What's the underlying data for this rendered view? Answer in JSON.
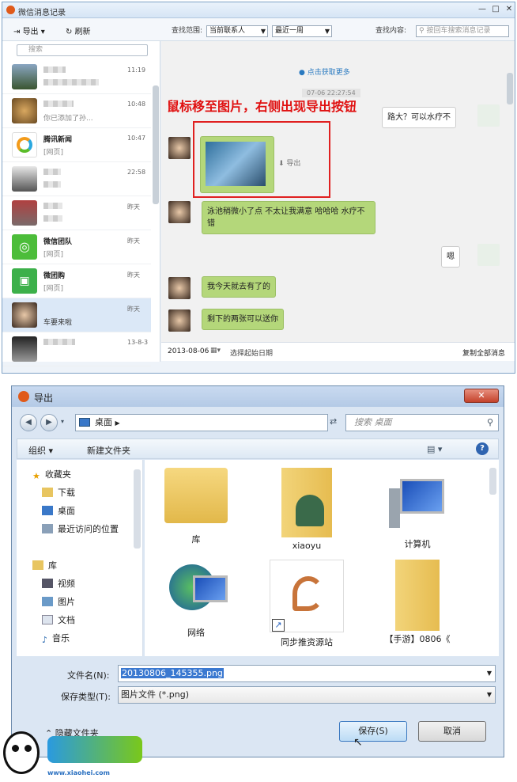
{
  "win1": {
    "title": "微信消息记录",
    "toolbar": {
      "export": "导出",
      "refresh": "刷新",
      "range_label": "查找范围:",
      "range_who": "当前联系人",
      "range_when": "最近一周",
      "content_label": "查找内容:",
      "content_placeholder": "按回车搜索消息记录"
    },
    "search_placeholder": "搜索",
    "contacts": [
      {
        "name": "",
        "msg": "",
        "time": "11:19"
      },
      {
        "name": "",
        "msg": "你已添加了孙...",
        "time": "10:48"
      },
      {
        "name": "腾讯新闻",
        "msg": "[网页]",
        "time": "10:47"
      },
      {
        "name": "",
        "msg": "",
        "time": "22:58"
      },
      {
        "name": "",
        "msg": "",
        "time": "昨天"
      },
      {
        "name": "微信团队",
        "msg": "[网页]",
        "time": "昨天"
      },
      {
        "name": "微团购",
        "msg": "[网页]",
        "time": "昨天"
      },
      {
        "name": "",
        "msg": "车要来啦",
        "time": "昨天"
      },
      {
        "name": "",
        "msg": "",
        "time": "13-8-3"
      }
    ],
    "chat": {
      "load_more": "点击获取更多",
      "timestamp": "07-06 22:27:54",
      "annotation": "鼠标移至图片，右侧出现导出按钮",
      "export_hint": "导出",
      "msgs": {
        "m1": "路大？可以水疗不",
        "m2": "泳池稍微小了点 不太让我满意 哈哈哈 水疗不错",
        "m3": "嗯",
        "m4": "我今天就去有了的",
        "m5": "剩下的两张可以送你"
      }
    },
    "footer": {
      "date": "2013-08-06",
      "pick": "选择起始日期",
      "copy_all": "复制全部消息"
    }
  },
  "win2": {
    "title": "导出",
    "path": "桌面",
    "search_placeholder": "搜索 桌面",
    "toolbar": {
      "organize": "组织",
      "new_folder": "新建文件夹"
    },
    "nav": {
      "favorites": "收藏夹",
      "download": "下载",
      "desktop": "桌面",
      "recent": "最近访问的位置",
      "libraries": "库",
      "video": "视频",
      "pictures": "图片",
      "docs": "文档",
      "music": "音乐"
    },
    "files": [
      "库",
      "xiaoyu",
      "计算机",
      "网络",
      "同步推资源站",
      "【手游】0806《"
    ],
    "filename_label": "文件名(N):",
    "filename": "20130806_145355.png",
    "filetype_label": "保存类型(T):",
    "filetype": "图片文件 (*.png)",
    "hide_folders": "隐藏文件夹",
    "save": "保存(S)",
    "cancel": "取消"
  },
  "logo": {
    "site": "www.xiaohei.com"
  }
}
